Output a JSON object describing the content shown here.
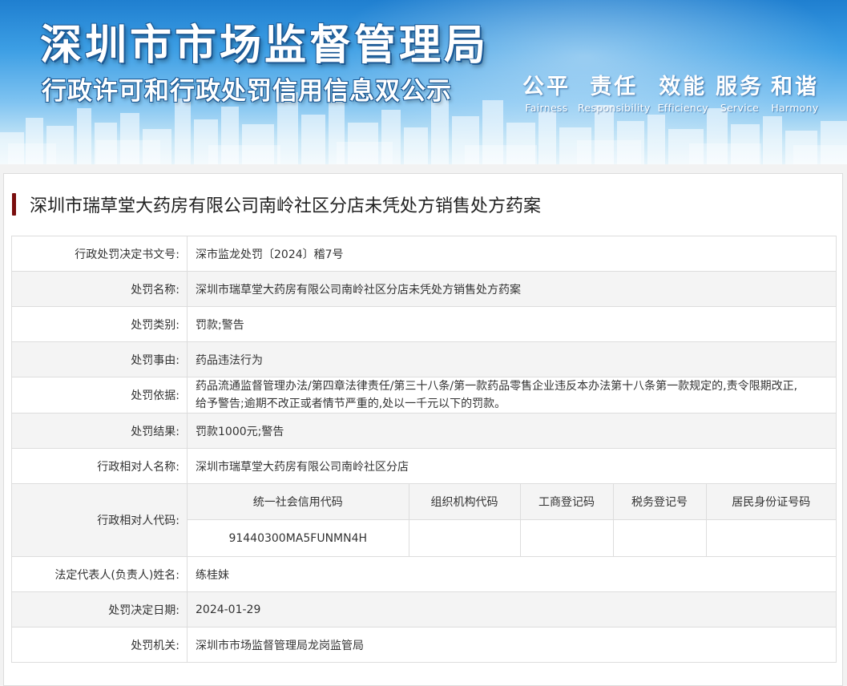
{
  "banner": {
    "title_main": "深圳市市场监督管理局",
    "title_sub": "行政许可和行政处罚信用信息双公示",
    "motto": [
      {
        "zh": "公平",
        "en": "Fairness"
      },
      {
        "zh": "责任",
        "en": "Responsibility"
      },
      {
        "zh": "效能",
        "en": "Efficiency"
      },
      {
        "zh": "服务",
        "en": "Service"
      },
      {
        "zh": "和谐",
        "en": "Harmony"
      }
    ]
  },
  "case": {
    "title": "深圳市瑞草堂大药房有限公司南岭社区分店未凭处方销售处方药案",
    "rows": {
      "doc_no": {
        "label": "行政处罚决定书文号:",
        "value": "深市监龙处罚〔2024〕稽7号"
      },
      "name": {
        "label": "处罚名称:",
        "value": "深圳市瑞草堂大药房有限公司南岭社区分店未凭处方销售处方药案"
      },
      "type": {
        "label": "处罚类别:",
        "value": "罚款;警告"
      },
      "reason": {
        "label": "处罚事由:",
        "value": "药品违法行为"
      },
      "basis": {
        "label": "处罚依据:",
        "line1": "药品流通监督管理办法/第四章法律责任/第三十八条/第一款药品零售企业违反本办法第十八条第一款规定的,责令限期改正,",
        "line2": "给予警告;逾期不改正或者情节严重的,处以一千元以下的罚款。"
      },
      "result": {
        "label": "处罚结果:",
        "value": "罚款1000元;警告"
      },
      "party_name": {
        "label": "行政相对人名称:",
        "value": "深圳市瑞草堂大药房有限公司南岭社区分店"
      },
      "party_code": {
        "label": "行政相对人代码:",
        "headers": [
          "统一社会信用代码",
          "组织机构代码",
          "工商登记码",
          "税务登记号",
          "居民身份证号码"
        ],
        "values": [
          "91440300MA5FUNMN4H",
          "",
          "",
          "",
          ""
        ]
      },
      "legal_rep": {
        "label": "法定代表人(负责人)姓名:",
        "value": "练桂妹"
      },
      "date": {
        "label": "处罚决定日期:",
        "value": "2024-01-29"
      },
      "authority": {
        "label": "处罚机关:",
        "value": "深圳市市场监督管理局龙岗监管局"
      }
    }
  }
}
